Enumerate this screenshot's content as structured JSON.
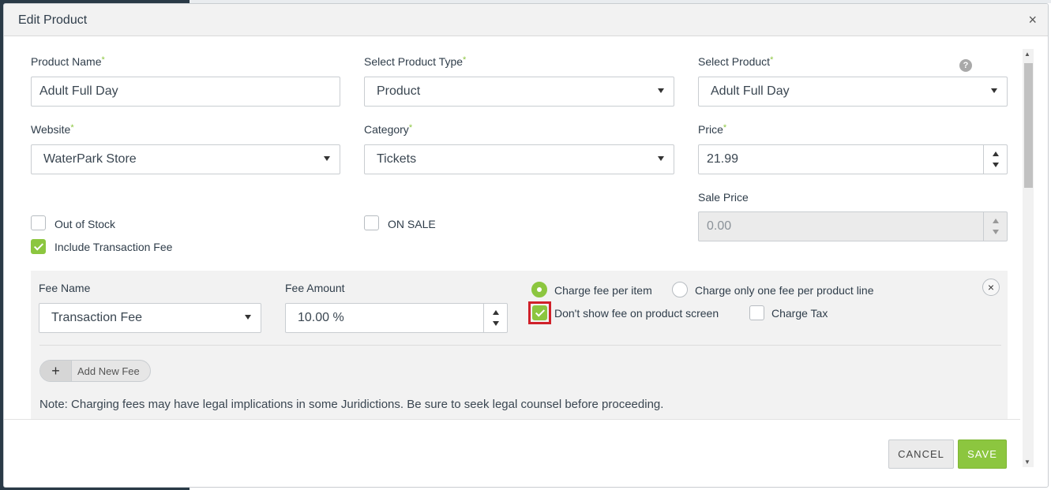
{
  "modal": {
    "title": "Edit Product",
    "close_glyph": "×"
  },
  "form": {
    "product_name": {
      "label": "Product Name",
      "value": "Adult Full Day"
    },
    "product_type": {
      "label": "Select Product Type",
      "value": "Product"
    },
    "product": {
      "label": "Select Product",
      "value": "Adult Full Day"
    },
    "website": {
      "label": "Website",
      "value": "WaterPark Store"
    },
    "category": {
      "label": "Category",
      "value": "Tickets"
    },
    "price": {
      "label": "Price",
      "value": "21.99"
    },
    "sale_price": {
      "label": "Sale Price",
      "value": "0.00"
    },
    "out_of_stock": {
      "label": "Out of Stock",
      "checked": false
    },
    "include_fee": {
      "label": "Include Transaction Fee",
      "checked": true
    },
    "on_sale": {
      "label": "ON SALE",
      "checked": false
    },
    "required_mark": "*",
    "help_glyph": "?"
  },
  "fee": {
    "name_label": "Fee Name",
    "name_value": "Transaction Fee",
    "amount_label": "Fee Amount",
    "amount_value": "10.00 %",
    "charge_per_item": "Charge fee per item",
    "charge_one_fee": "Charge only one fee per product line",
    "dont_show": "Don't show fee on product screen",
    "charge_tax": "Charge Tax",
    "remove_glyph": "×",
    "add_plus": "+",
    "add_label": "Add New Fee",
    "note": "Note: Charging fees may have legal implications in some Juridictions. Be sure to seek legal counsel before proceeding."
  },
  "footer": {
    "cancel": "CANCEL",
    "save": "SAVE"
  },
  "colors": {
    "accent": "#8cc63f",
    "highlight": "#d0212a"
  }
}
